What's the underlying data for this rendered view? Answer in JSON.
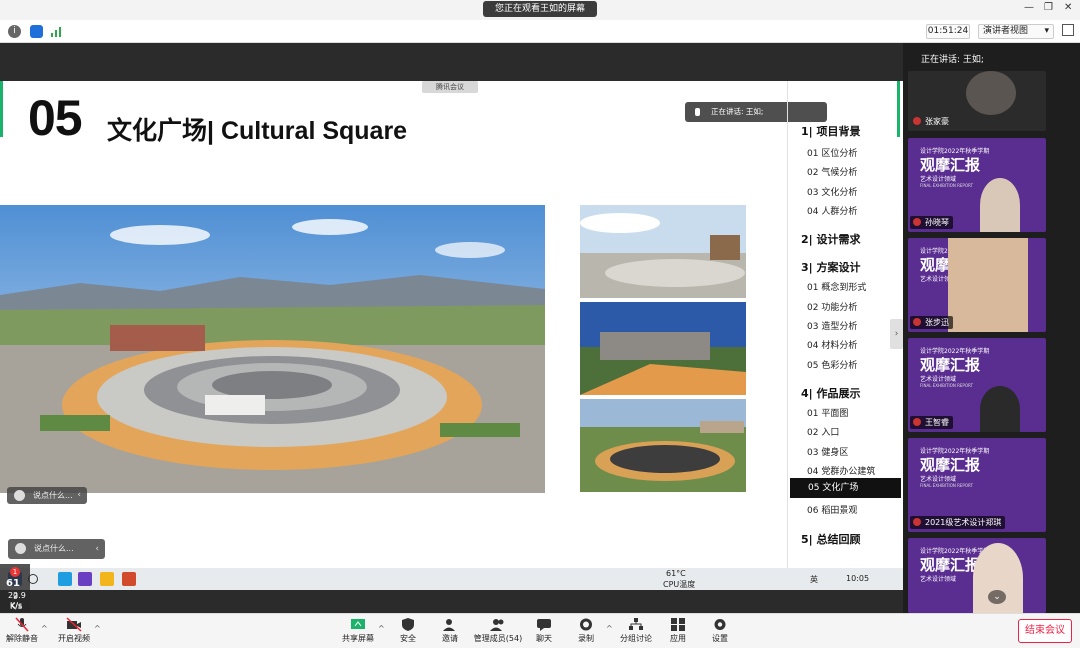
{
  "titlebar": {
    "viewing_text": "您正在观看王如的屏幕",
    "min_glyph": "—",
    "restore_glyph": "❐",
    "close_glyph": "✕"
  },
  "toolbar": {
    "timer": "01:51:24",
    "view_mode": "演讲者视图",
    "view_mode_caret": "▾"
  },
  "slide": {
    "number": "05",
    "title": "文化广场| Cultural Square",
    "meeting_chip": "腾讯会议",
    "speaking_overlay": "正在讲话: 王如;",
    "outline": {
      "sections": [
        {
          "label": "1| 项目背景",
          "items": [
            "01 区位分析",
            "02 气候分析",
            "03 文化分析",
            "04 人群分析"
          ]
        },
        {
          "label": "2| 设计需求",
          "items": []
        },
        {
          "label": "3| 方案设计",
          "items": [
            "01 概念到形式",
            "02 功能分析",
            "03 造型分析",
            "04 材料分析",
            "05 色彩分析"
          ]
        },
        {
          "label": "4| 作品展示",
          "items": [
            "01 平面图",
            "02 入口",
            "03 健身区",
            "04 党群办公建筑",
            "05 文化广场",
            "06 稻田景观"
          ]
        },
        {
          "label": "5| 总结回顾",
          "items": []
        }
      ],
      "active_item": "05 文化广场"
    },
    "chat_placeholder_inner": "说点什么...",
    "chat_placeholder_outer": "说点什么..."
  },
  "taskbar": {
    "temperature": "61°C",
    "cpu_label": "CPU温度",
    "ime_label": "英",
    "clock": "10:05"
  },
  "left_float": {
    "badge": "1",
    "count": "61",
    "net_up": "9",
    "unit1": "K/s",
    "net_down": "22.9",
    "unit2": "K/s"
  },
  "right_panel": {
    "speaking_header": "正在讲话: 王如;",
    "participants": [
      {
        "name": "张家豪"
      },
      {
        "name": "孙晓琴"
      },
      {
        "name": "张步迅"
      },
      {
        "name": "王智睿"
      },
      {
        "name": "2021级艺术设计郑琪"
      },
      {
        "name": ""
      }
    ],
    "poster": {
      "line1": "设计学院2022年秋季学期",
      "big": "观摩汇报",
      "sub": "艺术设计领域",
      "en": "FINAL EXHIBITION REPORT"
    },
    "collapse_glyph": "›",
    "scroll_down_glyph": "⌄"
  },
  "bottombar": {
    "buttons": [
      "解除静音",
      "开启视频",
      "共享屏幕",
      "安全",
      "邀请",
      "管理成员(54)",
      "聊天",
      "录制",
      "分组讨论",
      "应用",
      "设置"
    ],
    "end_meeting": "结束会议",
    "caret_glyph": "^"
  },
  "colors": {
    "accent_green": "#1bb36b",
    "end_red": "#e22244",
    "poster_purple": "#5a2d91"
  }
}
